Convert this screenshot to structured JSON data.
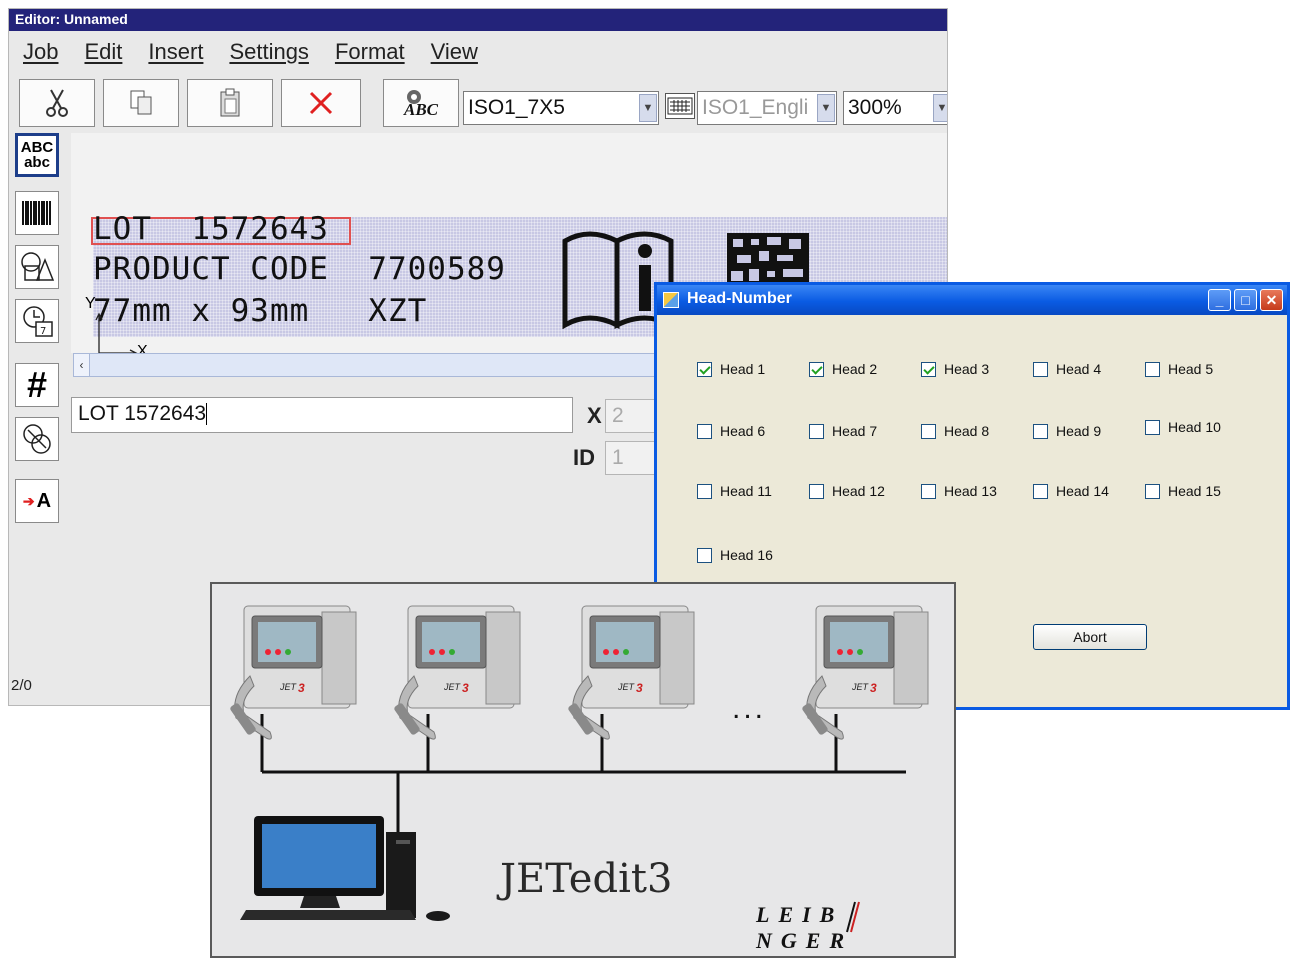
{
  "editor": {
    "title": "Editor: Unnamed",
    "menu": [
      "Job",
      "Edit",
      "Insert",
      "Settings",
      "Format",
      "View"
    ],
    "font_select": "ISO1_7X5",
    "language_select": "ISO1_Engli",
    "zoom_select": "300%",
    "label_lines": [
      "LOT  1572643",
      "PRODUCT CODE  7700589",
      "77mm x 93mm   XZT"
    ],
    "axis_y": "Y",
    "axis_x": "X",
    "text_value": "LOT 1572643",
    "x_label": "X",
    "x_value": "2",
    "id_label": "ID",
    "id_value": "1",
    "status": "2/0",
    "sidebar_text": {
      "abc_upper": "ABC",
      "abc_lower": "abc",
      "counter": "#",
      "variable": "A"
    }
  },
  "dialog": {
    "title": "Head-Number",
    "heads": [
      {
        "label": "Head 1",
        "checked": true
      },
      {
        "label": "Head 2",
        "checked": true
      },
      {
        "label": "Head 3",
        "checked": true
      },
      {
        "label": "Head 4",
        "checked": false
      },
      {
        "label": "Head 5",
        "checked": false
      },
      {
        "label": "Head 6",
        "checked": false
      },
      {
        "label": "Head 7",
        "checked": false
      },
      {
        "label": "Head 8",
        "checked": false
      },
      {
        "label": "Head 9",
        "checked": false
      },
      {
        "label": "Head 10",
        "checked": false
      },
      {
        "label": "Head 11",
        "checked": false
      },
      {
        "label": "Head 12",
        "checked": false
      },
      {
        "label": "Head 13",
        "checked": false
      },
      {
        "label": "Head 14",
        "checked": false
      },
      {
        "label": "Head 15",
        "checked": false
      },
      {
        "label": "Head 16",
        "checked": false
      }
    ],
    "abort_label": "Abort"
  },
  "network": {
    "ellipsis": "...",
    "app_name": "JETedit3",
    "brand": "LEIBINGER",
    "brand_left": "LEIB",
    "brand_right": "NGER",
    "printer_model": "JET3"
  }
}
